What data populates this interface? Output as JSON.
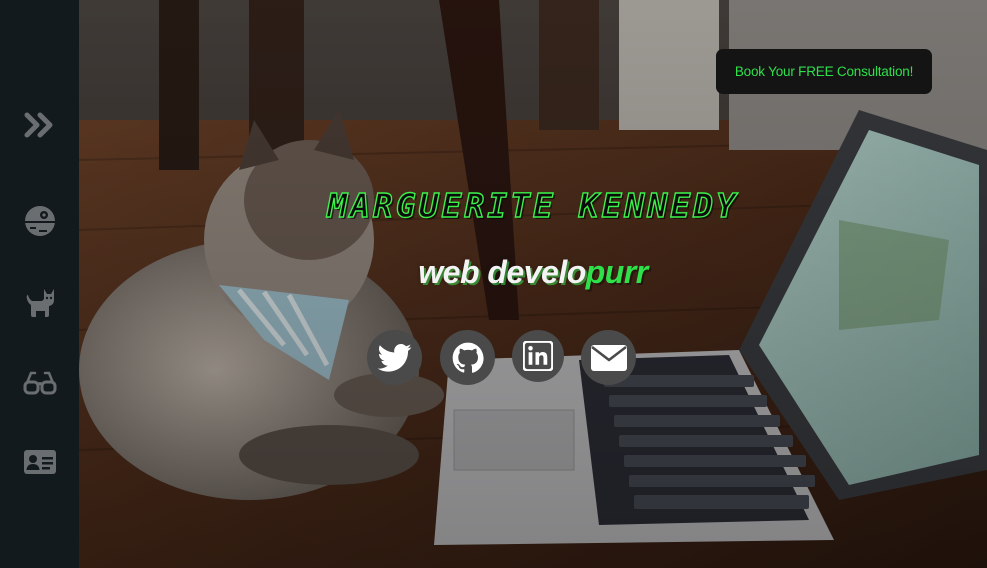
{
  "sidebar": {
    "items": [
      {
        "name": "expand",
        "icon": "double-chevron-right-icon"
      },
      {
        "name": "death-star",
        "icon": "death-star-icon"
      },
      {
        "name": "cat",
        "icon": "cat-icon"
      },
      {
        "name": "glasses",
        "icon": "glasses-icon"
      },
      {
        "name": "contact-card",
        "icon": "id-card-icon"
      }
    ],
    "icon_color": "#6b6e70"
  },
  "header": {
    "cta_label": "Book Your FREE Consultation!"
  },
  "hero": {
    "name": "MARGUERITE KENNEDY",
    "role_part1": "web develo",
    "role_part2": "purr"
  },
  "social": [
    {
      "name": "twitter",
      "icon": "twitter-icon"
    },
    {
      "name": "github",
      "icon": "github-icon"
    },
    {
      "name": "linkedin",
      "icon": "linkedin-icon"
    },
    {
      "name": "email",
      "icon": "envelope-icon"
    }
  ],
  "colors": {
    "accent": "#2ee04a",
    "sidebar_bg": "#131a1e",
    "cta_bg": "#141414",
    "social_bg": "#4a4a4a"
  }
}
